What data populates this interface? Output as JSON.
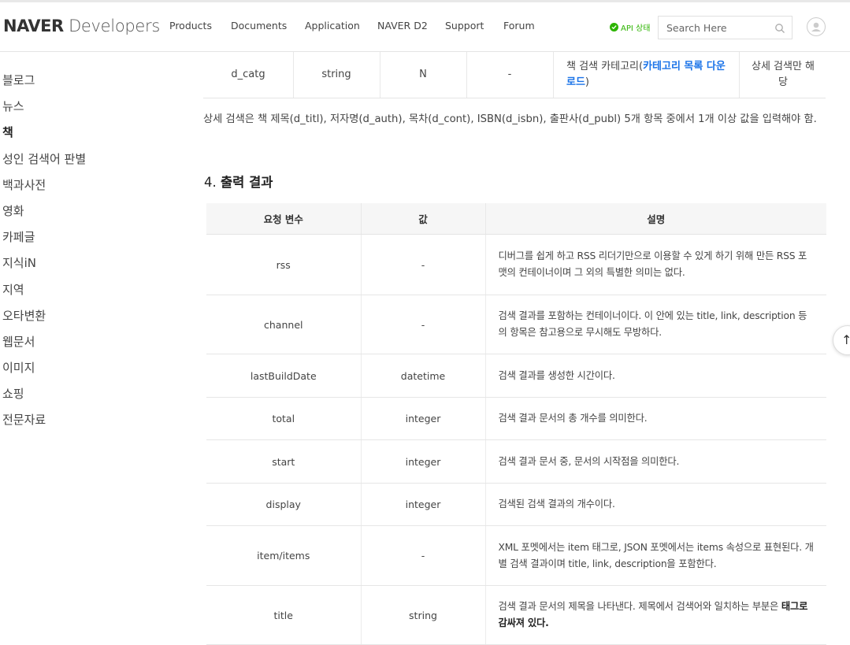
{
  "header": {
    "logo_bold": "NAVER",
    "logo_light": "Developers",
    "nav": [
      "Products",
      "Documents",
      "Application",
      "NAVER D2",
      "Support",
      "Forum"
    ],
    "api_status": "API 상태",
    "search_placeholder": "Search Here"
  },
  "sidebar": {
    "items": [
      "블로그",
      "뉴스",
      "책",
      "성인 검색어 판별",
      "백과사전",
      "영화",
      "카페글",
      "지식iN",
      "지역",
      "오타변환",
      "웹문서",
      "이미지",
      "쇼핑",
      "전문자료"
    ],
    "active": "책"
  },
  "param_row": {
    "name": "d_catg",
    "type": "string",
    "required": "N",
    "default": "-",
    "desc_prefix": "책 검색 카테고리(",
    "desc_link": "카테고리 목록 다운로드",
    "desc_suffix": ")",
    "note": "상세 검색만 해당"
  },
  "detail_note": "상세 검색은 책 제목(d_titl), 저자명(d_auth), 목차(d_cont), ISBN(d_isbn), 출판사(d_publ) 5개 항목 중에서 1개 이상 값을 입력해야 함.",
  "section": {
    "number": "4.",
    "title": "출력 결과"
  },
  "output_table": {
    "headers": [
      "요청 변수",
      "값",
      "설명"
    ],
    "rows": [
      {
        "name": "rss",
        "value": "-",
        "desc": "디버그를 쉽게 하고 RSS 리더기만으로 이용할 수 있게 하기 위해 만든 RSS 포맷의 컨테이너이며 그 외의 특별한 의미는 없다."
      },
      {
        "name": "channel",
        "value": "-",
        "desc": "검색 결과를 포함하는 컨테이너이다. 이 안에 있는 title, link, description 등의 항목은 참고용으로 무시해도 무방하다."
      },
      {
        "name": "lastBuildDate",
        "value": "datetime",
        "desc": "검색 결과를 생성한 시간이다."
      },
      {
        "name": "total",
        "value": "integer",
        "desc": "검색 결과 문서의 총 개수를 의미한다."
      },
      {
        "name": "start",
        "value": "integer",
        "desc": "검색 결과 문서 중, 문서의 시작점을 의미한다."
      },
      {
        "name": "display",
        "value": "integer",
        "desc": "검색된 검색 결과의 개수이다."
      },
      {
        "name": "item/items",
        "value": "-",
        "desc": "XML 포멧에서는 item 태그로, JSON 포멧에서는 items 속성으로 표현된다. 개별 검색 결과이며 title, link, description을 포함한다."
      },
      {
        "name": "title",
        "value": "string",
        "desc": "검색 결과 문서의 제목을 나타낸다. 제목에서 검색어와 일치하는 부분은 ",
        "desc_bold": "태그로 감싸져 있다."
      }
    ]
  },
  "scroll_top_icon": "arrow-up-icon",
  "colors": {
    "api_ok": "#2db400",
    "link": "#1a73e8",
    "header_bg": "#f6f6f6"
  }
}
